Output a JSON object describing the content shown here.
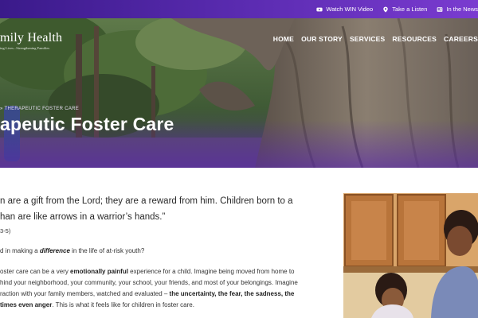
{
  "topbar": {
    "items": [
      {
        "label": "Watch WIN Video",
        "icon": "youtube-icon"
      },
      {
        "label": "Take a Listen",
        "icon": "location-pin-icon"
      },
      {
        "label": "In the News",
        "icon": "news-icon"
      }
    ]
  },
  "logo": {
    "main": "mily Health",
    "sub": "ing Lives...Strengthening Families"
  },
  "nav": {
    "items": [
      "HOME",
      "OUR STORY",
      "SERVICES",
      "RESOURCES",
      "CAREERS"
    ]
  },
  "hero": {
    "breadcrumb": "» THERAPEUTIC FOSTER CARE",
    "title": "apeutic Foster Care"
  },
  "content": {
    "quote_line1": "n are a gift from the Lord; they are a reward from him. Children born to a",
    "quote_line2": "han are like arrows in a warrior’s hands.”",
    "quote_ref": "3-5)",
    "question_pre": "d in making a ",
    "question_em": "difference",
    "question_post": " in the life of at-risk youth?",
    "para_l1_pre": "oster care can be a very ",
    "para_l1_bold": "emotionally painful",
    "para_l1_post": " experience for a child. Imagine being moved from home to",
    "para_l2": "hind your neighborhood, your community, your school, your friends, and most of your belongings. Imagine",
    "para_l3_pre": "raction with your family members, watched and evaluated – ",
    "para_l3_bold": "the uncertainty, the fear, the sadness, the",
    "para_l4_bold": "times even anger",
    "para_l4_post": ". This is what it feels like for children in foster care."
  },
  "colors": {
    "accent": "#5a2bb0",
    "topbar": "#3a1a8a"
  }
}
